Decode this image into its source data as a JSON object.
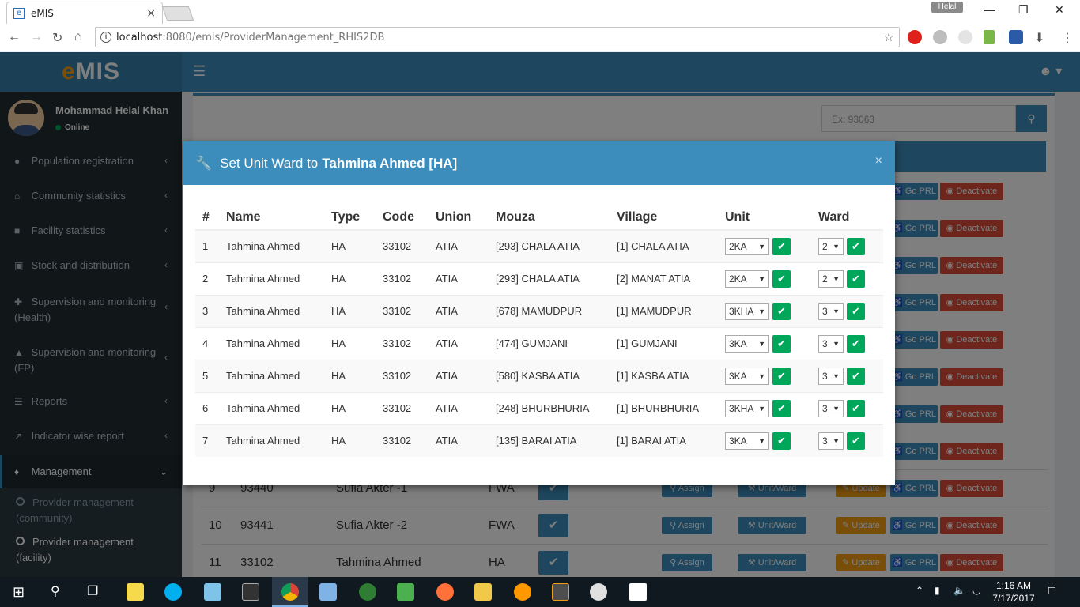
{
  "browser": {
    "tab_title": "eMIS",
    "tab_close": "×",
    "profile_name": "Helal",
    "url_host": "localhost",
    "url_path": ":8080/emis/ProviderManagement_RHIS2DB"
  },
  "app": {
    "logo_e": "e",
    "logo_rest": "MIS",
    "user_name": "Mohammad Helal Khan",
    "user_status": "Online",
    "search_placeholder": "Ex: 93063"
  },
  "sidebar": {
    "items": [
      {
        "label": "Population registration",
        "icon": "users-icon"
      },
      {
        "label": "Community statistics",
        "icon": "home-icon"
      },
      {
        "label": "Facility statistics",
        "icon": "briefcase-icon"
      },
      {
        "label": "Stock and distribution",
        "icon": "cubes-icon"
      },
      {
        "label": "Supervision and monitoring",
        "label2": "(Health)",
        "icon": "plus-icon"
      },
      {
        "label": "Supervision and monitoring",
        "label2": "(FP)",
        "icon": "building-icon"
      },
      {
        "label": "Reports",
        "icon": "list-icon"
      },
      {
        "label": "Indicator wise report",
        "icon": "chart-icon"
      },
      {
        "label": "Management",
        "icon": "puzzle-icon"
      }
    ],
    "sub_items": [
      {
        "label": "Provider management",
        "label2": "(community)"
      },
      {
        "label": "Provider management",
        "label2": "(facility)"
      }
    ]
  },
  "modal": {
    "title_prefix": "Set Unit Ward to",
    "title_name": "Tahmina Ahmed [HA]",
    "close": "×",
    "headers": [
      "#",
      "Name",
      "Type",
      "Code",
      "Union",
      "Mouza",
      "Village",
      "Unit",
      "Ward"
    ],
    "rows": [
      {
        "no": "1",
        "name": "Tahmina Ahmed",
        "type": "HA",
        "code": "33102",
        "union": "ATIA",
        "mouza": "[293] CHALA ATIA",
        "village": "[1] CHALA ATIA",
        "unit": "2KA",
        "ward": "2"
      },
      {
        "no": "2",
        "name": "Tahmina Ahmed",
        "type": "HA",
        "code": "33102",
        "union": "ATIA",
        "mouza": "[293] CHALA ATIA",
        "village": "[2] MANAT ATIA",
        "unit": "2KA",
        "ward": "2"
      },
      {
        "no": "3",
        "name": "Tahmina Ahmed",
        "type": "HA",
        "code": "33102",
        "union": "ATIA",
        "mouza": "[678] MAMUDPUR",
        "village": "[1] MAMUDPUR",
        "unit": "3KHA",
        "ward": "3"
      },
      {
        "no": "4",
        "name": "Tahmina Ahmed",
        "type": "HA",
        "code": "33102",
        "union": "ATIA",
        "mouza": "[474] GUMJANI",
        "village": "[1] GUMJANI",
        "unit": "3KA",
        "ward": "3"
      },
      {
        "no": "5",
        "name": "Tahmina Ahmed",
        "type": "HA",
        "code": "33102",
        "union": "ATIA",
        "mouza": "[580] KASBA ATIA",
        "village": "[1] KASBA ATIA",
        "unit": "3KA",
        "ward": "3"
      },
      {
        "no": "6",
        "name": "Tahmina Ahmed",
        "type": "HA",
        "code": "33102",
        "union": "ATIA",
        "mouza": "[248] BHURBHURIA",
        "village": "[1] BHURBHURIA",
        "unit": "3KHA",
        "ward": "3"
      },
      {
        "no": "7",
        "name": "Tahmina Ahmed",
        "type": "HA",
        "code": "33102",
        "union": "ATIA",
        "mouza": "[135] BARAI ATIA",
        "village": "[1] BARAI ATIA",
        "unit": "3KA",
        "ward": "3"
      }
    ]
  },
  "background_table": {
    "rows": [
      {
        "no": "9",
        "code": "93440",
        "name": "Sufia Akter -1",
        "type": "FWA"
      },
      {
        "no": "10",
        "code": "93441",
        "name": "Sufia Akter -2",
        "type": "FWA"
      },
      {
        "no": "11",
        "code": "33102",
        "name": "Tahmina Ahmed",
        "type": "HA"
      }
    ],
    "btn_assign": "Assign",
    "btn_unitward": "Unit/Ward",
    "btn_update": "Update",
    "btn_goprl": "Go PRL",
    "btn_deactivate": "Deactivate"
  },
  "taskbar": {
    "time": "1:16 AM",
    "date": "7/17/2017"
  },
  "colors": {
    "primary": "#3c8dbc",
    "success": "#00a65a",
    "sidebar": "#222d32"
  }
}
